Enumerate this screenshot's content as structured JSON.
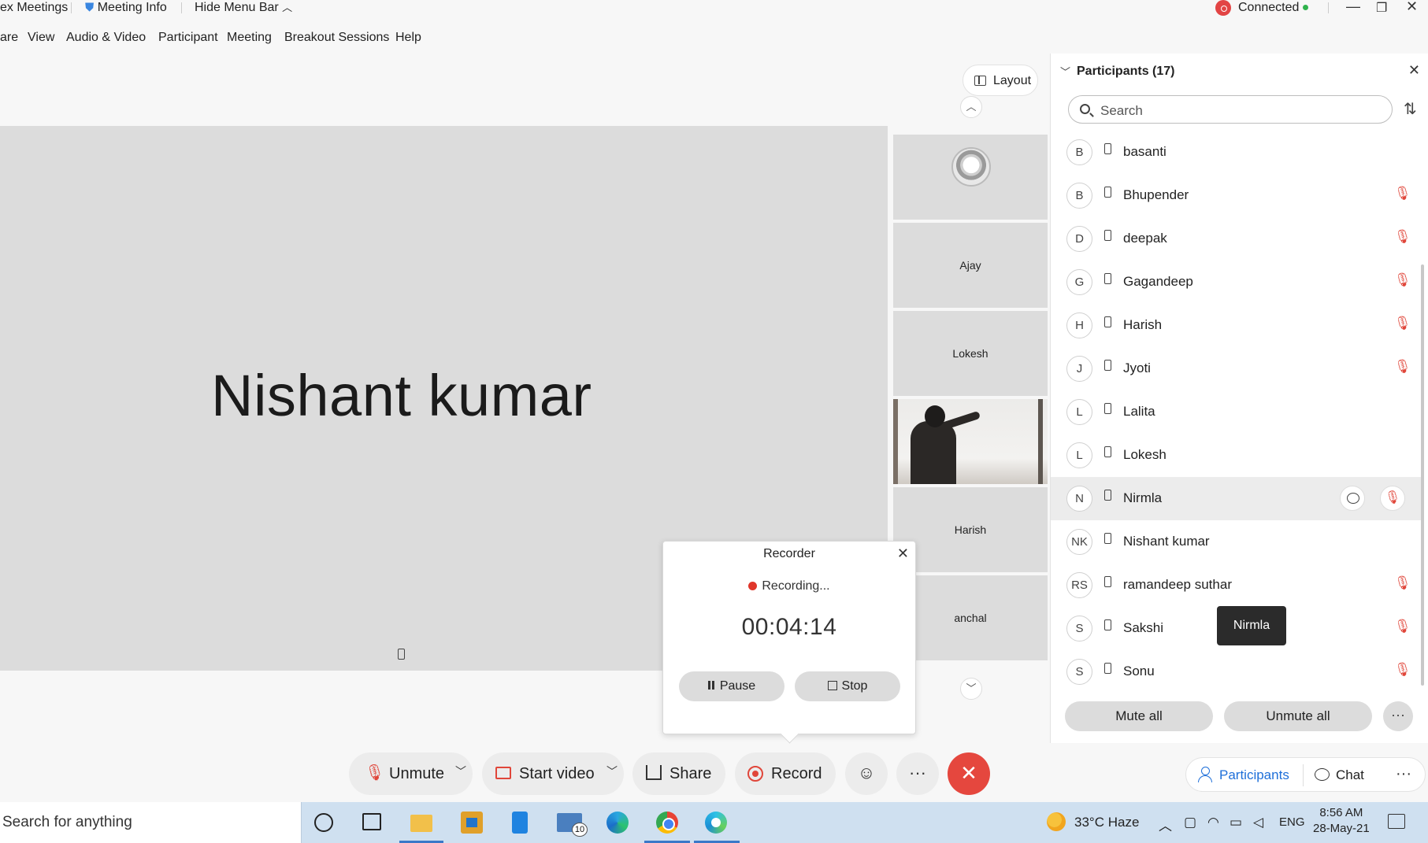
{
  "titlebar": {
    "app_name": "ex Meetings",
    "meeting_info": "Meeting Info",
    "hide_menu_bar": "Hide Menu Bar",
    "status": "Connected"
  },
  "menu": [
    "are",
    "View",
    "Audio & Video",
    "Participant",
    "Meeting",
    "Breakout Sessions",
    "Help"
  ],
  "stage": {
    "speaker_name": "Nishant kumar",
    "layout_label": "Layout"
  },
  "tiles": [
    "",
    "Ajay",
    "Lokesh",
    "",
    "Harish",
    "anchal"
  ],
  "recorder": {
    "title": "Recorder",
    "status": "Recording...",
    "time": "00:04:14",
    "pause_label": "Pause",
    "stop_label": "Stop"
  },
  "toolbar": {
    "unmute": "Unmute",
    "start_video": "Start video",
    "share": "Share",
    "record": "Record"
  },
  "participants": {
    "header": "Participants (17)",
    "search_placeholder": "Search",
    "list": [
      {
        "initials": "B",
        "name": "basanti",
        "muted": false
      },
      {
        "initials": "B",
        "name": "Bhupender",
        "muted": true
      },
      {
        "initials": "D",
        "name": "deepak",
        "muted": true
      },
      {
        "initials": "G",
        "name": "Gagandeep",
        "muted": true
      },
      {
        "initials": "H",
        "name": "Harish",
        "muted": true
      },
      {
        "initials": "J",
        "name": "Jyoti",
        "muted": true
      },
      {
        "initials": "L",
        "name": "Lalita",
        "muted": false
      },
      {
        "initials": "L",
        "name": "Lokesh",
        "muted": false
      },
      {
        "initials": "N",
        "name": "Nirmla",
        "muted": true,
        "highlighted": true
      },
      {
        "initials": "NK",
        "name": "Nishant kumar",
        "muted": false
      },
      {
        "initials": "RS",
        "name": "ramandeep suthar",
        "muted": true
      },
      {
        "initials": "S",
        "name": "Sakshi",
        "muted": true
      },
      {
        "initials": "S",
        "name": "Sonu",
        "muted": true
      }
    ],
    "tooltip": "Nirmla",
    "mute_all": "Mute all",
    "unmute_all": "Unmute all"
  },
  "bottom_tabs": {
    "participants": "Participants",
    "chat": "Chat"
  },
  "taskbar": {
    "search_placeholder": "Search for anything",
    "mail_badge": "10",
    "weather": "33°C Haze",
    "language": "ENG",
    "time": "8:56 AM",
    "date": "28-May-21"
  },
  "colors": {
    "end_call": "#e5473e",
    "accent_blue": "#1e6fd9",
    "muted_red": "#e0463a",
    "recording_red": "#e0362a"
  }
}
